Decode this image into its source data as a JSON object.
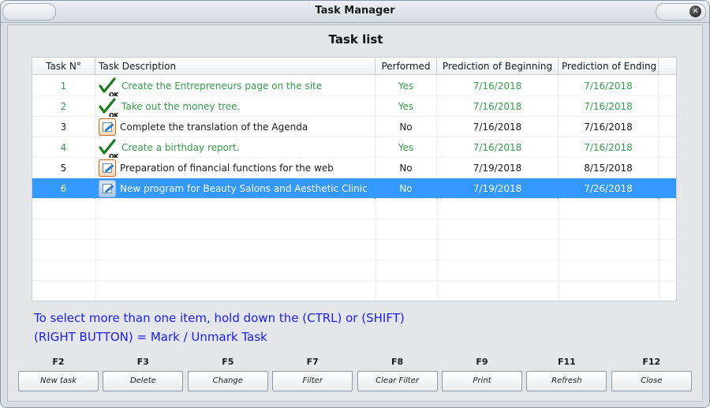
{
  "window": {
    "title": "Task Manager"
  },
  "list_heading": "Task list",
  "columns": [
    "Task N°",
    "Task Description",
    "Performed",
    "Prediction of Beginning",
    "Prediction of Ending"
  ],
  "rows": [
    {
      "num": "1",
      "desc": "Create the Entrepreneurs page on the site",
      "performed": "Yes",
      "begin": "7/16/2018",
      "end": "7/16/2018",
      "icon": "ok-check-icon",
      "color": "#3a9a4e"
    },
    {
      "num": "2",
      "desc": "Take out the money tree.",
      "performed": "Yes",
      "begin": "7/16/2018",
      "end": "7/16/2018",
      "icon": "ok-check-icon",
      "color": "#3a9a4e"
    },
    {
      "num": "3",
      "desc": "Complete the translation of the Agenda",
      "performed": "No",
      "begin": "7/16/2018",
      "end": "7/16/2018",
      "icon": "edit-task-icon",
      "color": "#1a1a1a"
    },
    {
      "num": "4",
      "desc": "Create a birthday report.",
      "performed": "Yes",
      "begin": "7/16/2018",
      "end": "7/16/2018",
      "icon": "ok-check-icon",
      "color": "#3a9a4e"
    },
    {
      "num": "5",
      "desc": "Preparation of financial functions for the web",
      "performed": "No",
      "begin": "7/19/2018",
      "end": "8/15/2018",
      "icon": "edit-task-icon",
      "color": "#1a1a1a"
    },
    {
      "num": "6",
      "desc": "New program for Beauty Salons and Aesthetic Clinic",
      "performed": "No",
      "begin": "7/19/2018",
      "end": "7/26/2018",
      "icon": "edit-task-icon",
      "color": "#ffffff",
      "selected": true
    }
  ],
  "ok_label": "OK",
  "hints": {
    "line1": "To select more than one item, hold down the (CTRL) or (SHIFT)",
    "line2": "(RIGHT BUTTON) = Mark / Unmark Task"
  },
  "buttons": [
    {
      "key": "F2",
      "label": "New task",
      "name": "new-task-button"
    },
    {
      "key": "F3",
      "label": "Delete",
      "name": "delete-button"
    },
    {
      "key": "F5",
      "label": "Change",
      "name": "change-button"
    },
    {
      "key": "F7",
      "label": "Filter",
      "name": "filter-button"
    },
    {
      "key": "F8",
      "label": "Clear Filter",
      "name": "clear-filter-button"
    },
    {
      "key": "F9",
      "label": "Print",
      "name": "print-button"
    },
    {
      "key": "F11",
      "label": "Refresh",
      "name": "refresh-button"
    },
    {
      "key": "F12",
      "label": "Close",
      "name": "close-button"
    }
  ],
  "colors": {
    "selection": "#3399ff",
    "done_text": "#3a9a4e",
    "hint_text": "#1c21e0"
  }
}
